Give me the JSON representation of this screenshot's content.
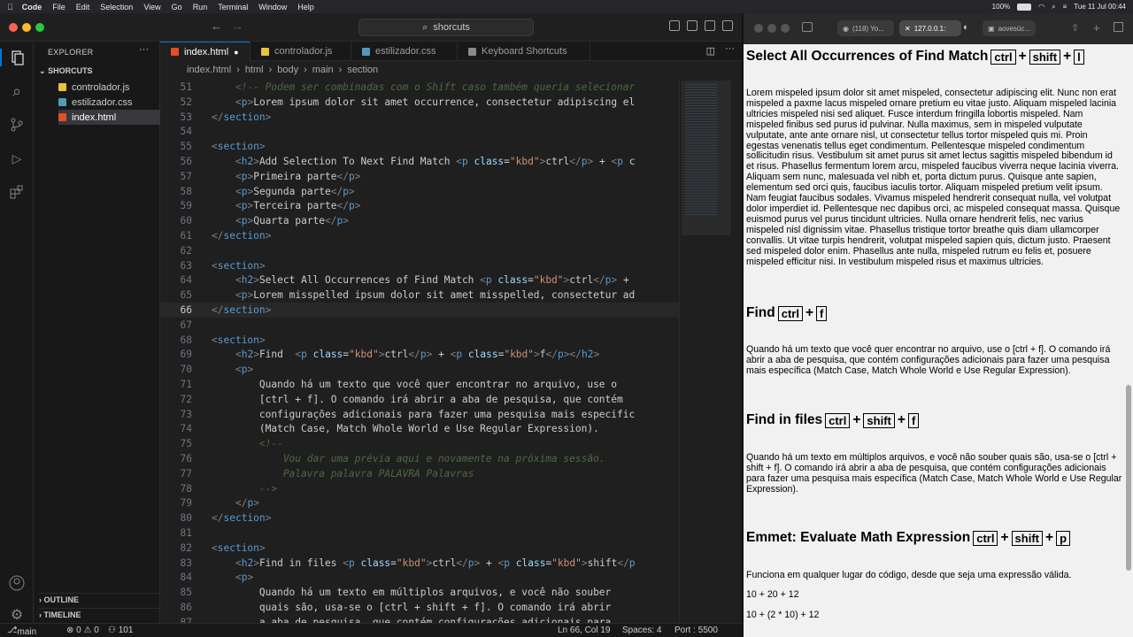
{
  "menubar": {
    "app": "Code",
    "items": [
      "File",
      "Edit",
      "Selection",
      "View",
      "Go",
      "Run",
      "Terminal",
      "Window",
      "Help"
    ],
    "battery": "100%",
    "datetime": "Tue 11 Jul  00:44"
  },
  "titlebar": {
    "search": "shorcuts"
  },
  "explorer": {
    "header": "EXPLORER",
    "folder": "SHORCUTS",
    "files": [
      {
        "name": "controlador.js",
        "color": "#e8c33a"
      },
      {
        "name": "estilizador.css",
        "color": "#519aba"
      },
      {
        "name": "index.html",
        "color": "#e44d26"
      }
    ],
    "outline": "OUTLINE",
    "timeline": "TIMELINE"
  },
  "tabs": [
    {
      "label": "index.html",
      "color": "#e44d26",
      "modified": "●"
    },
    {
      "label": "controlador.js",
      "color": "#e8c33a"
    },
    {
      "label": "estilizador.css",
      "color": "#519aba"
    },
    {
      "label": "Keyboard Shortcuts",
      "color": "#8a8a8a"
    }
  ],
  "breadcrumb": [
    "index.html",
    "html",
    "body",
    "main",
    "section"
  ],
  "editor": {
    "current_line": 66,
    "lines": [
      {
        "n": 51,
        "html": "<span class=\"c\">    &lt;!-- Podem ser combinadas com o Shift caso também queria selecionar</span>"
      },
      {
        "n": 52,
        "html": "    <span class=\"tg\">&lt;</span><span class=\"t\">p</span><span class=\"tg\">&gt;</span>Lorem ipsum dolor sit amet occurrence, consectetur adipiscing el"
      },
      {
        "n": 53,
        "html": "<span class=\"tg\">&lt;/</span><span class=\"t\">section</span><span class=\"tg\">&gt;</span>"
      },
      {
        "n": 54,
        "html": ""
      },
      {
        "n": 55,
        "html": "<span class=\"tg\">&lt;</span><span class=\"t\">section</span><span class=\"tg\">&gt;</span>"
      },
      {
        "n": 56,
        "html": "    <span class=\"tg\">&lt;</span><span class=\"t\">h2</span><span class=\"tg\">&gt;</span>Add Selection To Next Find Match <span class=\"tg\">&lt;</span><span class=\"t\">p</span> <span class=\"a\">class</span>=<span class=\"s\">\"kbd\"</span><span class=\"tg\">&gt;</span>ctrl<span class=\"tg\">&lt;/</span><span class=\"t\">p</span><span class=\"tg\">&gt;</span> + <span class=\"tg\">&lt;</span><span class=\"t\">p</span> <span class=\"a\">c</span>"
      },
      {
        "n": 57,
        "html": "    <span class=\"tg\">&lt;</span><span class=\"t\">p</span><span class=\"tg\">&gt;</span>Primeira parte<span class=\"tg\">&lt;/</span><span class=\"t\">p</span><span class=\"tg\">&gt;</span>"
      },
      {
        "n": 58,
        "html": "    <span class=\"tg\">&lt;</span><span class=\"t\">p</span><span class=\"tg\">&gt;</span>Segunda parte<span class=\"tg\">&lt;/</span><span class=\"t\">p</span><span class=\"tg\">&gt;</span>"
      },
      {
        "n": 59,
        "html": "    <span class=\"tg\">&lt;</span><span class=\"t\">p</span><span class=\"tg\">&gt;</span>Terceira parte<span class=\"tg\">&lt;/</span><span class=\"t\">p</span><span class=\"tg\">&gt;</span>"
      },
      {
        "n": 60,
        "html": "    <span class=\"tg\">&lt;</span><span class=\"t\">p</span><span class=\"tg\">&gt;</span>Quarta parte<span class=\"tg\">&lt;/</span><span class=\"t\">p</span><span class=\"tg\">&gt;</span>"
      },
      {
        "n": 61,
        "html": "<span class=\"tg\">&lt;/</span><span class=\"t\">section</span><span class=\"tg\">&gt;</span>"
      },
      {
        "n": 62,
        "html": ""
      },
      {
        "n": 63,
        "html": "<span class=\"tg\">&lt;</span><span class=\"t\">section</span><span class=\"tg\">&gt;</span>"
      },
      {
        "n": 64,
        "html": "    <span class=\"tg\">&lt;</span><span class=\"t\">h2</span><span class=\"tg\">&gt;</span>Select All Occurrences of Find Match <span class=\"tg\">&lt;</span><span class=\"t\">p</span> <span class=\"a\">class</span>=<span class=\"s\">\"kbd\"</span><span class=\"tg\">&gt;</span>ctrl<span class=\"tg\">&lt;/</span><span class=\"t\">p</span><span class=\"tg\">&gt;</span> +"
      },
      {
        "n": 65,
        "html": "    <span class=\"tg\">&lt;</span><span class=\"t\">p</span><span class=\"tg\">&gt;</span>Lorem misspelled ipsum dolor sit amet misspelled, consectetur ad"
      },
      {
        "n": 66,
        "html": "<span class=\"tg\">&lt;/</span><span class=\"t\">section</span><span class=\"tg\">&gt;</span>"
      },
      {
        "n": 67,
        "html": ""
      },
      {
        "n": 68,
        "html": "<span class=\"tg\">&lt;</span><span class=\"t\">section</span><span class=\"tg\">&gt;</span>"
      },
      {
        "n": 69,
        "html": "    <span class=\"tg\">&lt;</span><span class=\"t\">h2</span><span class=\"tg\">&gt;</span>Find  <span class=\"tg\">&lt;</span><span class=\"t\">p</span> <span class=\"a\">class</span>=<span class=\"s\">\"kbd\"</span><span class=\"tg\">&gt;</span>ctrl<span class=\"tg\">&lt;/</span><span class=\"t\">p</span><span class=\"tg\">&gt;</span> + <span class=\"tg\">&lt;</span><span class=\"t\">p</span> <span class=\"a\">class</span>=<span class=\"s\">\"kbd\"</span><span class=\"tg\">&gt;</span>f<span class=\"tg\">&lt;/</span><span class=\"t\">p</span><span class=\"tg\">&gt;&lt;/</span><span class=\"t\">h2</span><span class=\"tg\">&gt;</span>"
      },
      {
        "n": 70,
        "html": "    <span class=\"tg\">&lt;</span><span class=\"t\">p</span><span class=\"tg\">&gt;</span>"
      },
      {
        "n": 71,
        "html": "        Quando há um texto que você quer encontrar no arquivo, use o"
      },
      {
        "n": 72,
        "html": "        [ctrl + f]. O comando irá abrir a aba de pesquisa, que contém"
      },
      {
        "n": 73,
        "html": "        configurações adicionais para fazer uma pesquisa mais especific"
      },
      {
        "n": 74,
        "html": "        (Match Case, Match Whole World e Use Regular Expression)."
      },
      {
        "n": 75,
        "html": "<span class=\"c\">        &lt;!--</span>"
      },
      {
        "n": 76,
        "html": "<span class=\"c\">            Vou dar uma prévia aqui e novamente na próxima sessão.</span>"
      },
      {
        "n": 77,
        "html": "<span class=\"c\">            Palavra palavra PALAVRA Palavras</span>"
      },
      {
        "n": 78,
        "html": "<span class=\"c\">        --&gt;</span>"
      },
      {
        "n": 79,
        "html": "    <span class=\"tg\">&lt;/</span><span class=\"t\">p</span><span class=\"tg\">&gt;</span>"
      },
      {
        "n": 80,
        "html": "<span class=\"tg\">&lt;/</span><span class=\"t\">section</span><span class=\"tg\">&gt;</span>"
      },
      {
        "n": 81,
        "html": ""
      },
      {
        "n": 82,
        "html": "<span class=\"tg\">&lt;</span><span class=\"t\">section</span><span class=\"tg\">&gt;</span>"
      },
      {
        "n": 83,
        "html": "    <span class=\"tg\">&lt;</span><span class=\"t\">h2</span><span class=\"tg\">&gt;</span>Find in files <span class=\"tg\">&lt;</span><span class=\"t\">p</span> <span class=\"a\">class</span>=<span class=\"s\">\"kbd\"</span><span class=\"tg\">&gt;</span>ctrl<span class=\"tg\">&lt;/</span><span class=\"t\">p</span><span class=\"tg\">&gt;</span> + <span class=\"tg\">&lt;</span><span class=\"t\">p</span> <span class=\"a\">class</span>=<span class=\"s\">\"kbd\"</span><span class=\"tg\">&gt;</span>shift<span class=\"tg\">&lt;/</span><span class=\"t\">p</span>"
      },
      {
        "n": 84,
        "html": "    <span class=\"tg\">&lt;</span><span class=\"t\">p</span><span class=\"tg\">&gt;</span>"
      },
      {
        "n": 85,
        "html": "        Quando há um texto em múltiplos arquivos, e você não souber"
      },
      {
        "n": 86,
        "html": "        quais são, usa-se o [ctrl + shift + f]. O comando irá abrir"
      },
      {
        "n": 87,
        "html": "        a aba de pesquisa, que contém configurações adicionais para"
      }
    ]
  },
  "status": {
    "branch": "main",
    "problems": "⊗ 0 ⚠ 0",
    "ports": "⚇ 101",
    "cursor": "Ln 66, Col 19",
    "spaces": "Spaces: 4",
    "port": "Port : 5500"
  },
  "browser": {
    "tabs": [
      "(118) Yo...",
      "127.0.0.1:",
      "aovesüc..."
    ]
  },
  "page": {
    "sections": [
      {
        "title": "Select All Occurrences of Find Match",
        "keys": [
          "ctrl",
          "shift",
          "l"
        ],
        "paragraphs": [
          "Lorem mispeled ipsum dolor sit amet mispeled, consectetur adipiscing elit. Nunc non erat mispeled a paxme lacus mispeled ornare pretium eu vitae justo. Aliquam mispeled lacinia ultricies mispeled nisi sed aliquet. Fusce interdum fringilla lobortis mispeled. Nam mispeled finibus sed purus id pulvinar. Nulla maximus, sem in mispeled vulputate vulputate, ante ante ornare nisl, ut consectetur tellus tortor mispeled quis mi. Proin egestas venenatis tellus eget condimentum. Pellentesque mispeled condimentum sollicitudin risus. Vestibulum sit amet purus sit amet lectus sagittis mispeled bibendum id et risus. Phasellus fermentum lorem arcu, mispeled faucibus viverra neque lacinia viverra. Aliquam sem nunc, malesuada vel nibh et, porta dictum purus. Quisque ante sapien, elementum sed orci quis, faucibus iaculis tortor. Aliquam mispeled pretium velit ipsum. Nam feugiat faucibus sodales. Vivamus mispeled hendrerit consequat nulla, vel volutpat dolor imperdiet id. Pellentesque nec dapibus orci, ac mispeled consequat massa. Quisque euismod purus vel purus tincidunt ultricies. Nulla ornare hendrerit felis, nec varius mispeled nisl dignissim vitae. Phasellus tristique tortor breathe quis diam ullamcorper convallis. Ut vitae turpis hendrerit, volutpat mispeled sapien quis, dictum justo. Praesent sed mispeled dolor enim. Phasellus ante nulla, mispeled rutrum eu felis et, posuere mispeled efficitur nisi. In vestibulum mispeled risus et maximus ultricies."
        ]
      },
      {
        "title": "Find",
        "keys": [
          "ctrl",
          "f"
        ],
        "paragraphs": [
          "Quando há um texto que você quer encontrar no arquivo, use o [ctrl + f]. O comando irá abrir a aba de pesquisa, que contém configurações adicionais para fazer uma pesquisa mais específica (Match Case, Match Whole World e Use Regular Expression)."
        ]
      },
      {
        "title": "Find in files",
        "keys": [
          "ctrl",
          "shift",
          "f"
        ],
        "paragraphs": [
          "Quando há um texto em múltiplos arquivos, e você não souber quais são, usa-se o [ctrl + shift + f]. O comando irá abrir a aba de pesquisa, que contém configurações adicionais para fazer uma pesquisa mais específica (Match Case, Match Whole World e Use Regular Expression)."
        ]
      },
      {
        "title": "Emmet: Evaluate Math Expression",
        "keys": [
          "ctrl",
          "shift",
          "p"
        ],
        "paragraphs": [
          "Funciona em qualquer lugar do código, desde que seja uma expressão válida.",
          "10 + 20 + 12",
          "10 + (2 * 10) + 12"
        ]
      }
    ]
  }
}
